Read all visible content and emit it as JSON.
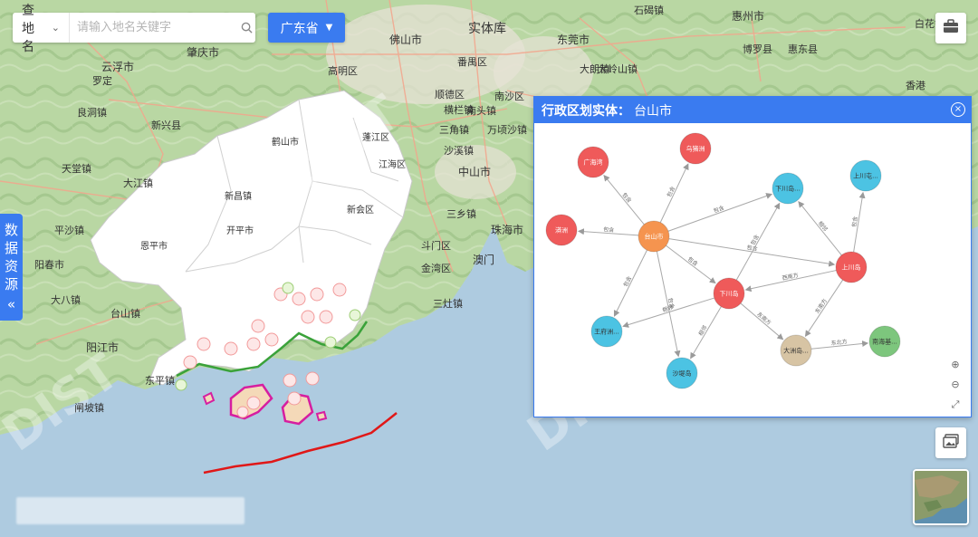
{
  "search": {
    "type_label": "查地名",
    "placeholder": "请输入地名关键字"
  },
  "province_selector": {
    "label": "广东省"
  },
  "side_tab": {
    "chars": [
      "数",
      "据",
      "资",
      "源"
    ],
    "toggle": "«"
  },
  "map": {
    "watermark": "DIST",
    "place_labels": [
      "佛山市",
      "实体库",
      "东莞市",
      "惠州市",
      "云浮市",
      "肇庆市",
      "高明区",
      "鹤山市",
      "江海区",
      "蓬江区",
      "开平市",
      "恩平市",
      "新会区",
      "中山市",
      "珠海市",
      "澳门",
      "阳江市",
      "台山镇",
      "东平镇",
      "大八镇",
      "阳春市",
      "新兴县",
      "罗定",
      "大江镇",
      "天堂镇",
      "顺德区",
      "南沙区",
      "番禺区",
      "三乡镇",
      "斗门区",
      "金湾区",
      "三灶镇",
      "香港",
      "大朗镇",
      "石碣镇",
      "闸坡镇",
      "新昌镇",
      "良洞镇",
      "南头镇",
      "大岭山镇",
      "平沙镇",
      "三角镇",
      "万顷沙镇",
      "横栏镇",
      "沙溪镇",
      "博罗县",
      "惠东县",
      "白花镇"
    ]
  },
  "panel": {
    "title_label": "行政区划实体：",
    "title_value": "台山市",
    "close_glyph": "×",
    "zoom": {
      "zoom_in": "⊕",
      "zoom_out": "⊖",
      "fit": "⤢"
    }
  },
  "graph": {
    "nodes": [
      {
        "id": "n1",
        "label": "台山市",
        "color": "#f5944f"
      },
      {
        "id": "n2",
        "label": "广海湾",
        "color": "#ef5a5a"
      },
      {
        "id": "n3",
        "label": "乌猪洲",
        "color": "#ef5a5a"
      },
      {
        "id": "n4",
        "label": "漭洲",
        "color": "#ef5a5a"
      },
      {
        "id": "n5",
        "label": "下川岛",
        "color": "#ef5a5a"
      },
      {
        "id": "n6",
        "label": "上川岛",
        "color": "#ef5a5a"
      },
      {
        "id": "n7",
        "label": "下川岛...",
        "color": "#4cc3e3"
      },
      {
        "id": "n8",
        "label": "上川屯...",
        "color": "#4cc3e3"
      },
      {
        "id": "n9",
        "label": "王府洲...",
        "color": "#4cc3e3"
      },
      {
        "id": "n10",
        "label": "沙堤岛",
        "color": "#4cc3e3"
      },
      {
        "id": "n11",
        "label": "大洲岛...",
        "color": "#d7c4a4"
      },
      {
        "id": "n12",
        "label": "南海基...",
        "color": "#7dc67d"
      }
    ],
    "edges": [
      {
        "from": "n1",
        "to": "n2",
        "label": "包含"
      },
      {
        "from": "n1",
        "to": "n3",
        "label": "包含"
      },
      {
        "from": "n1",
        "to": "n4",
        "label": "包含"
      },
      {
        "from": "n1",
        "to": "n7",
        "label": "包含"
      },
      {
        "from": "n1",
        "to": "n5",
        "label": "包含"
      },
      {
        "from": "n1",
        "to": "n6",
        "label": "包含"
      },
      {
        "from": "n1",
        "to": "n9",
        "label": "包含"
      },
      {
        "from": "n1",
        "to": "n10",
        "label": "包含"
      },
      {
        "from": "n5",
        "to": "n7",
        "label": "包含"
      },
      {
        "from": "n5",
        "to": "n9",
        "label": "相邻"
      },
      {
        "from": "n5",
        "to": "n10",
        "label": "相邻"
      },
      {
        "from": "n5",
        "to": "n11",
        "label": "东南方"
      },
      {
        "from": "n6",
        "to": "n5",
        "label": "西南方"
      },
      {
        "from": "n6",
        "to": "n7",
        "label": "相邻"
      },
      {
        "from": "n6",
        "to": "n8",
        "label": "包含"
      },
      {
        "from": "n6",
        "to": "n11",
        "label": "东南方"
      },
      {
        "from": "n11",
        "to": "n12",
        "label": "东北方"
      }
    ]
  }
}
